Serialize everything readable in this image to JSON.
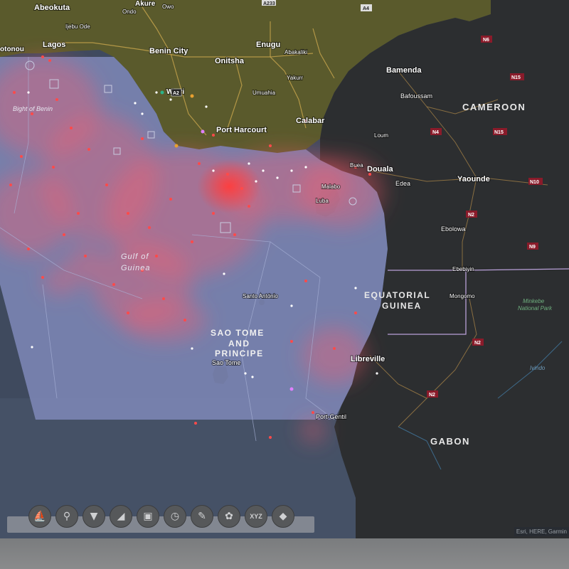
{
  "map": {
    "place_labels": {
      "abeokuta": "Abeokuta",
      "ondo": "Ondo",
      "akure": "Akure",
      "owo": "Owo",
      "a233": "A233",
      "a4": "A4",
      "otonou": "otonou",
      "ijebu_ode": "Ijebu Ode",
      "lagos": "Lagos",
      "benin_city": "Benin City",
      "enugu": "Enugu",
      "abakaliki": "Abakaliki",
      "onitsha": "Onitsha",
      "bamenda": "Bamenda",
      "n6": "N6",
      "n15a": "N15",
      "n15b": "N15",
      "bafoussam": "Bafoussam",
      "yakurr": "Yakurr",
      "umuahia": "Umuahia",
      "warri": "Warri",
      "a2": "A2",
      "bight_of_benin": "Bight of Benin",
      "port_harcourt": "Port Harcourt",
      "calabar": "Calabar",
      "cameroon": "CAMEROON",
      "n4": "N4",
      "loum": "Loum",
      "buea": "Buea",
      "douala": "Douala",
      "edea": "Edea",
      "yaounde": "Yaounde",
      "n10": "N10",
      "malabo": "Malabo",
      "luba": "Luba",
      "n2a": "N2",
      "ebolowa": "Ebolowa",
      "n9": "N9",
      "gulf_of_guinea_1": "Gulf of",
      "gulf_of_guinea_2": "Guinea",
      "ebebiyin": "Ebebiyin",
      "equatorial_guinea_1": "EQUATORIAL",
      "equatorial_guinea_2": "GUINEA",
      "mongomo": "Mongomo",
      "santo_antonio": "Santo António",
      "minkebe_1": "Minkebe",
      "minkebe_2": "National Park",
      "sao_tome_principe_1": "SAO TOME",
      "sao_tome_principe_2": "AND",
      "sao_tome_principe_3": "PRINCIPE",
      "sao_tome": "Sao Tome",
      "n2b": "N2",
      "libreville": "Libreville",
      "ivindo": "Ivindo",
      "n2c": "N2",
      "port_gentil": "Port-Gentil",
      "gabon": "GABON"
    },
    "attribution": "Esri, HERE, Garmin"
  },
  "toolbar": {
    "tools": [
      {
        "name": "basemap-tool",
        "icon": "mapping-icon",
        "glyph": "⛵"
      },
      {
        "name": "location-tool",
        "icon": "pin-icon",
        "glyph": "⚲"
      },
      {
        "name": "filter-tool",
        "icon": "filter-icon",
        "glyph": "▼"
      },
      {
        "name": "draw-tool",
        "icon": "triangle-icon",
        "glyph": "◢"
      },
      {
        "name": "layers-tool",
        "icon": "image-layer-icon",
        "glyph": "▣"
      },
      {
        "name": "time-tool",
        "icon": "clock-icon",
        "glyph": "◷"
      },
      {
        "name": "measure-tool",
        "icon": "ruler-icon",
        "glyph": "✎"
      },
      {
        "name": "style-tool",
        "icon": "palette-icon",
        "glyph": "✿"
      },
      {
        "name": "coordinates-tool",
        "icon": "xyz-icon",
        "glyph": "XYZ"
      },
      {
        "name": "stack-tool",
        "icon": "layer-stack-icon",
        "glyph": "◆"
      }
    ]
  },
  "colors": {
    "ocean": "#7b84b4",
    "land_dark": "#2c2e30",
    "land_olive": "#5e5c2a",
    "heat": "#ff4a4a",
    "road": "#c9a64e"
  }
}
